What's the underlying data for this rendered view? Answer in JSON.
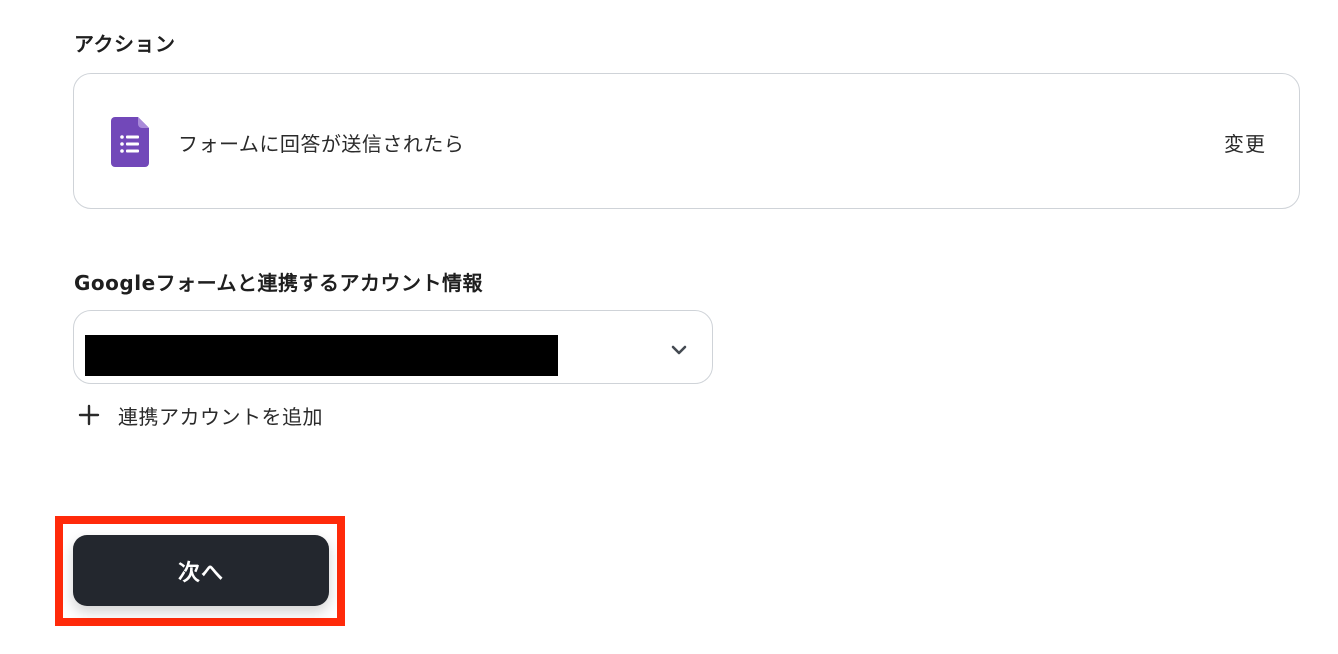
{
  "action_section": {
    "title": "アクション",
    "card": {
      "icon": "google-forms-icon",
      "label": "フォームに回答が送信されたら",
      "change_label": "変更"
    }
  },
  "account_section": {
    "title": "Googleフォームと連携するアカウント情報",
    "select": {
      "value": "",
      "redacted": true
    },
    "add_account_label": "連携アカウントを追加"
  },
  "footer": {
    "next_label": "次へ"
  },
  "colors": {
    "forms_purple": "#7248b9",
    "button_dark": "#23272e",
    "highlight_red": "#ff2a0a",
    "border_gray": "#cfd3d8"
  }
}
